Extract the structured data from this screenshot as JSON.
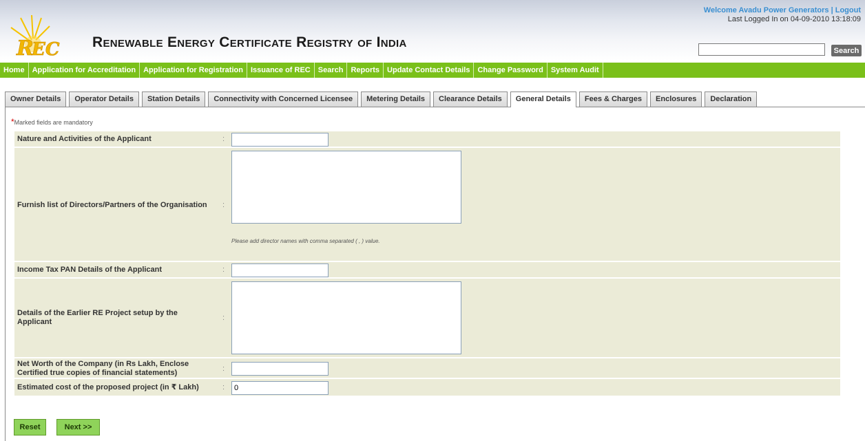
{
  "header": {
    "title": "Renewable Energy Certificate Registry of India",
    "logo_text": "REC",
    "welcome": "Welcome Avadu Power Generators",
    "separator": "|",
    "logout": "Logout",
    "last_login": "Last Logged In on 04-09-2010 13:18:09",
    "search_value": "",
    "search_label": "Search"
  },
  "nav": {
    "items": [
      "Home",
      "Application for Accreditation",
      "Application for Registration",
      "Issuance of REC",
      "Search",
      "Reports",
      "Update Contact Details",
      "Change Password",
      "System Audit"
    ]
  },
  "tabs": {
    "items": [
      "Owner Details",
      "Operator Details",
      "Station Details",
      "Connectivity with Concerned Licensee",
      "Metering Details",
      "Clearance Details",
      "General Details",
      "Fees & Charges",
      "Enclosures",
      "Declaration"
    ],
    "active": "General Details"
  },
  "form": {
    "mandatory_star": "*",
    "mandatory_note": "Marked fields are mandatory",
    "colon": ":",
    "fields": [
      {
        "label": "Nature and Activities of the Applicant",
        "value": ""
      },
      {
        "label": "Furnish list of Directors/Partners of the Organisation",
        "value": "",
        "hint": "Please add director names with comma separated ( , ) value."
      },
      {
        "label": "Income Tax PAN Details of the Applicant",
        "value": ""
      },
      {
        "label": "Details of the Earlier RE Project setup by the Applicant",
        "value": ""
      },
      {
        "label": "Net Worth of the Company (in Rs Lakh, Enclose Certified true copies of financial statements)",
        "value": ""
      },
      {
        "label": "Estimated cost of the proposed project (in ₹ Lakh)",
        "value": "0"
      }
    ]
  },
  "buttons": {
    "reset": "Reset",
    "next": "Next >>"
  },
  "colors": {
    "nav_green": "#7ac01a",
    "row_bg": "#ebebd7",
    "button_green": "#8fd35a",
    "welcome_blue": "#3a8fd1",
    "mandatory_red": "#d40000"
  },
  "icons": {
    "logo": "rec-sun-logo-icon",
    "mandatory": "asterisk-icon"
  }
}
